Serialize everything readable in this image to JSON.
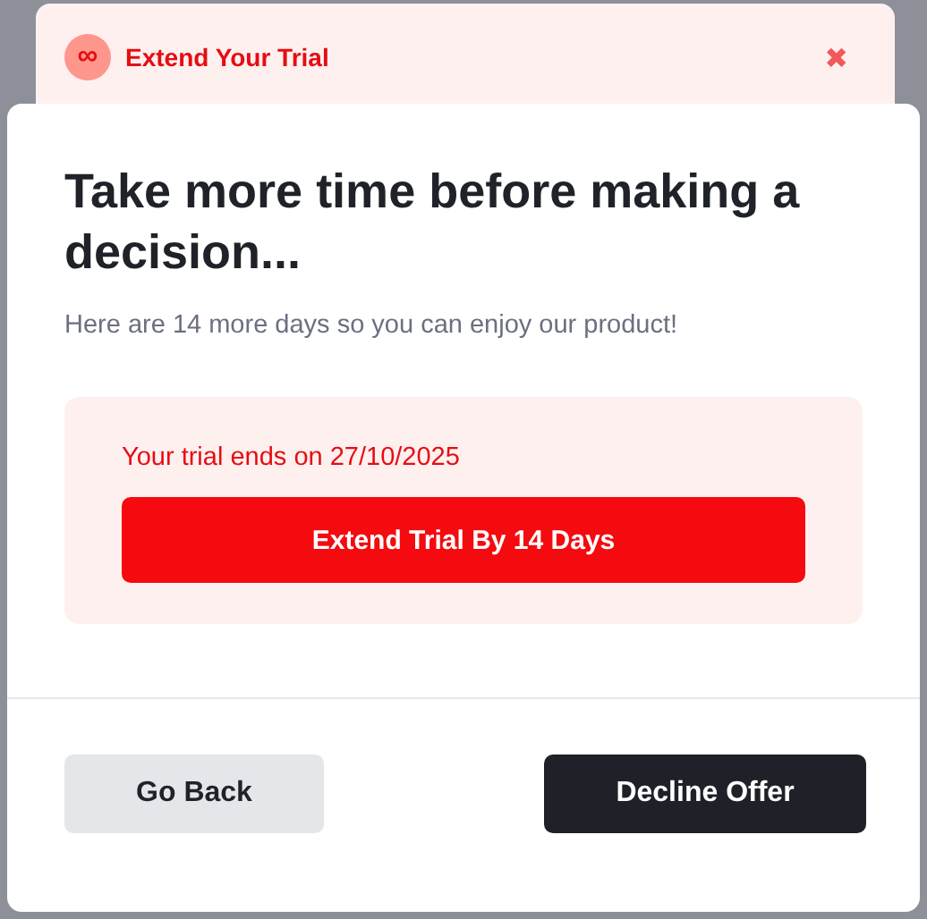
{
  "banner": {
    "icon_text": "∞",
    "title": "Extend Your Trial",
    "close": "✖"
  },
  "dialog": {
    "heading": "Take more time before making a decision...",
    "subtitle": "Here are 14 more days so you can enjoy our product!",
    "offer": {
      "notice": "Your trial ends on 27/10/2025",
      "button": "Extend Trial By 14 Days"
    },
    "buttons": [
      {
        "label": "Go Back",
        "kind": "secondary"
      },
      {
        "label": "Decline Offer",
        "kind": "primary"
      }
    ]
  }
}
